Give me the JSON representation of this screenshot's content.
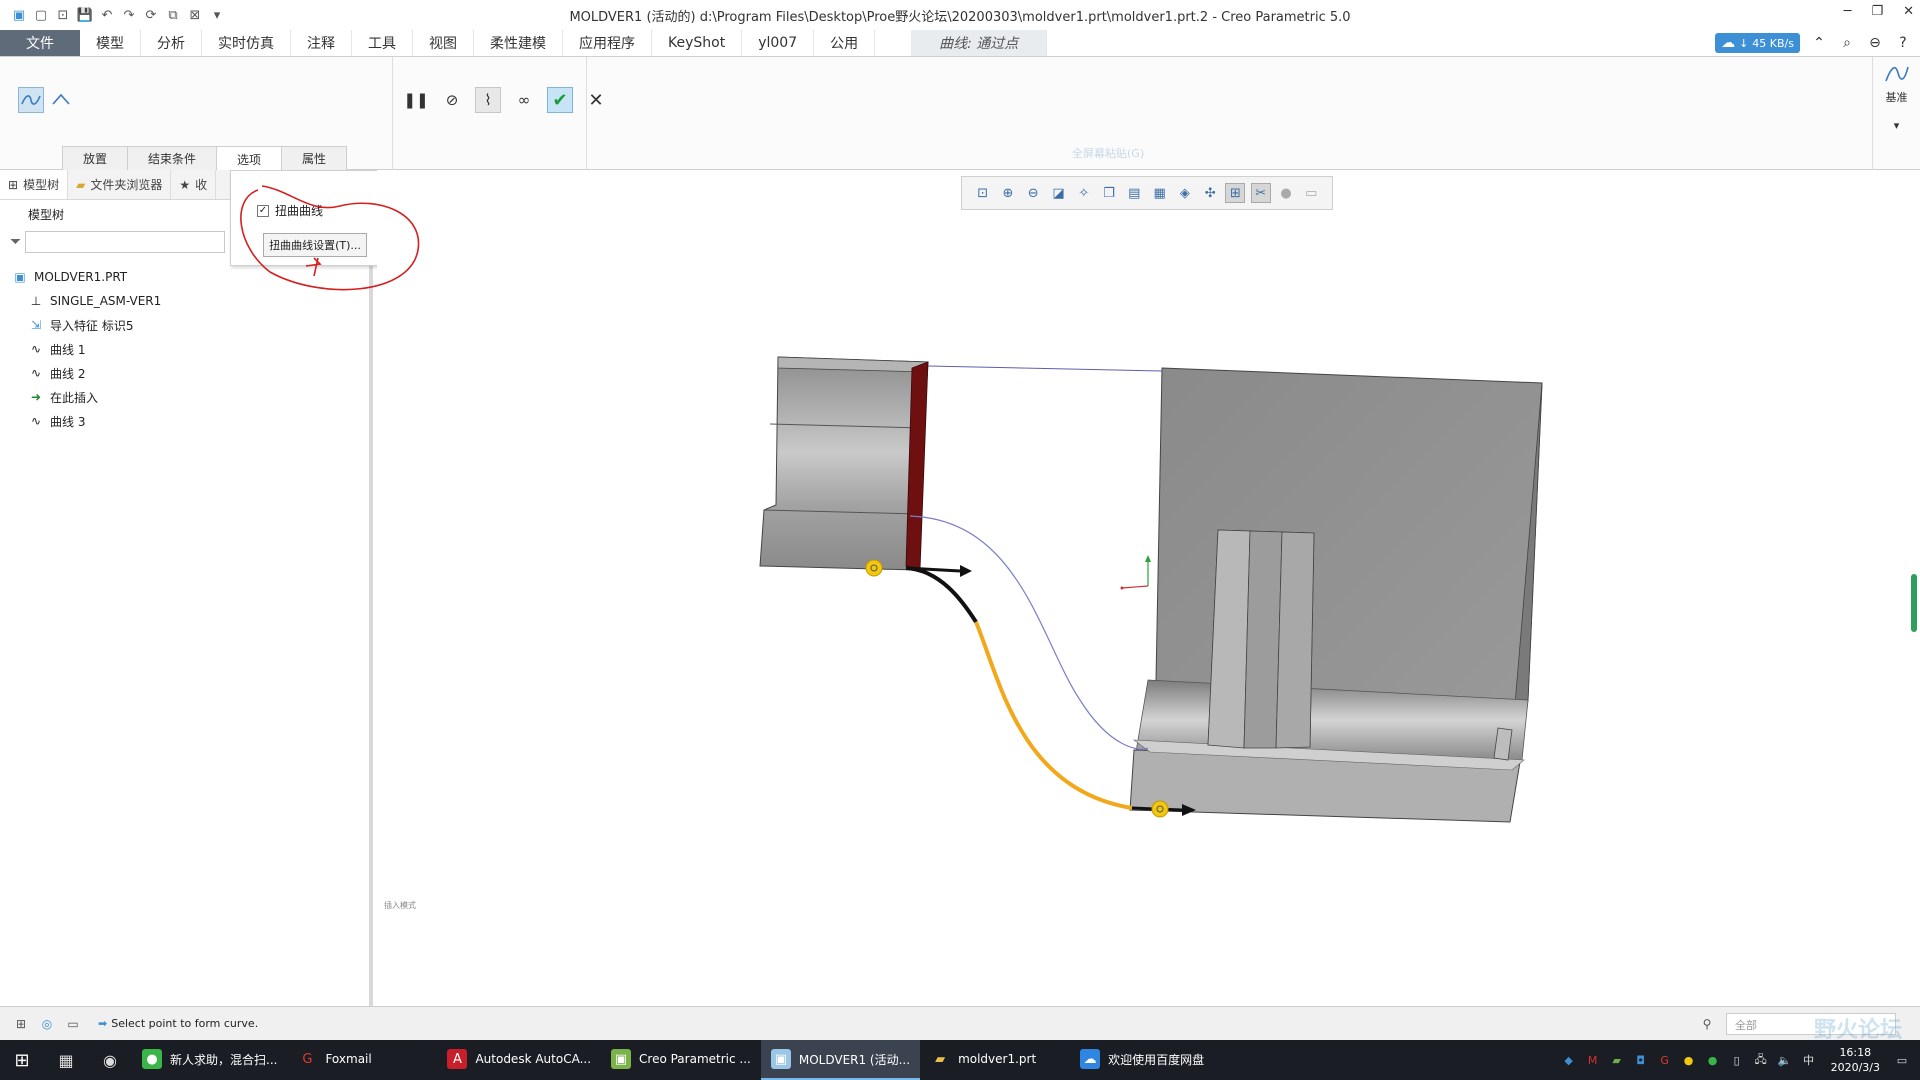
{
  "window": {
    "title": "MOLDVER1 (活动的) d:\\Program Files\\Desktop\\Proe野火论坛\\20200303\\moldver1.prt\\moldver1.prt.2 - Creo Parametric 5.0"
  },
  "ribbon_tabs": {
    "file": "文件",
    "items": [
      "模型",
      "分析",
      "实时仿真",
      "注释",
      "工具",
      "视图",
      "柔性建模",
      "应用程序",
      "KeyShot",
      "yl007",
      "公用"
    ],
    "contextual": "曲线: 通过点"
  },
  "network": {
    "speed": "45 KB/s"
  },
  "ribbon": {
    "subtabs": [
      "放置",
      "结束条件",
      "选项",
      "属性"
    ],
    "selected_subtab": "选项",
    "datum_label": "基准",
    "faint_label": "全屏幕粘贴(G)"
  },
  "options_popup": {
    "checkbox_label": "扭曲曲线",
    "checkbox_checked": true,
    "button_label": "扭曲曲线设置(T)..."
  },
  "navigator": {
    "tabs": [
      "模型树",
      "文件夹浏览器",
      "收"
    ],
    "header": "模型树",
    "filter_placeholder": "",
    "tree": [
      {
        "label": "MOLDVER1.PRT",
        "icon": "part-icon",
        "level": 0
      },
      {
        "label": "SINGLE_ASM-VER1",
        "icon": "coordinate-system-icon",
        "level": 1
      },
      {
        "label": "导入特征 标识5",
        "icon": "import-feature-icon",
        "level": 1
      },
      {
        "label": "曲线 1",
        "icon": "curve-icon",
        "level": 1
      },
      {
        "label": "曲线 2",
        "icon": "curve-icon",
        "level": 1
      },
      {
        "label": "在此插入",
        "icon": "insert-here-arrow-icon",
        "level": 1
      },
      {
        "label": "曲线 3",
        "icon": "curve-new-icon",
        "level": 1
      }
    ]
  },
  "graphics": {
    "small_text": "插入模式"
  },
  "status": {
    "message": "Select point to form curve.",
    "filter": "全部",
    "watermark": "野火论坛"
  },
  "taskbar": {
    "apps": [
      {
        "label": "新人求助，混合扫...",
        "icon": "browser-icon",
        "color": "#3ab54a",
        "active": false
      },
      {
        "label": "Foxmail",
        "icon": "foxmail-icon",
        "color": "#e03a2e",
        "active": false
      },
      {
        "label": "Autodesk AutoCA...",
        "icon": "autocad-icon",
        "color": "#c8202a",
        "active": false
      },
      {
        "label": "Creo Parametric ...",
        "icon": "creo-icon",
        "color": "#7bb24a",
        "active": false
      },
      {
        "label": "MOLDVER1 (活动...",
        "icon": "creo-window-icon",
        "color": "#9cc6e6",
        "active": true
      },
      {
        "label": "moldver1.prt",
        "icon": "folder-icon",
        "color": "#e8c04a",
        "active": false
      },
      {
        "label": "欢迎使用百度网盘",
        "icon": "baidu-netdisk-icon",
        "color": "#2f86e0",
        "active": false
      }
    ],
    "ime": "中",
    "time": "16:18",
    "date": "2020/3/3"
  },
  "colors": {
    "file_tab": "#5f6b78",
    "model_gray": "#9a9a9a",
    "highlight_curve": "#f2a81c",
    "edge_maroon": "#6e1010",
    "annotation_red": "#d42020",
    "ok_green": "#1e9a3c"
  }
}
